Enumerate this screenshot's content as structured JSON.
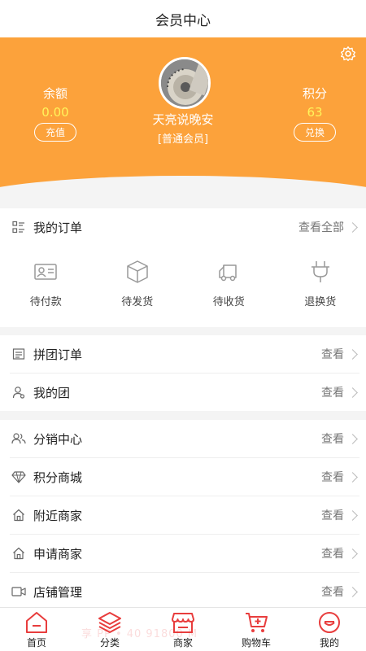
{
  "header": {
    "title": "会员中心"
  },
  "profile": {
    "nickname": "天亮说晚安",
    "level": "[普通会员]",
    "balance": {
      "label": "余额",
      "value": "0.00",
      "button": "充值"
    },
    "points": {
      "label": "积分",
      "value": "63",
      "button": "兑换"
    }
  },
  "orders": {
    "title": "我的订单",
    "view_all": "查看全部",
    "statuses": [
      {
        "label": "待付款",
        "icon": "id-card-icon"
      },
      {
        "label": "待发货",
        "icon": "box-icon"
      },
      {
        "label": "待收货",
        "icon": "truck-icon"
      },
      {
        "label": "退换货",
        "icon": "plug-icon"
      }
    ]
  },
  "group": {
    "rows": [
      {
        "title": "拼团订单",
        "more": "查看",
        "icon": "list-icon"
      },
      {
        "title": "我的团",
        "more": "查看",
        "icon": "user-icon"
      }
    ]
  },
  "services": {
    "rows": [
      {
        "title": "分销中心",
        "more": "查看",
        "icon": "users-icon"
      },
      {
        "title": "积分商城",
        "more": "查看",
        "icon": "diamond-icon"
      },
      {
        "title": "附近商家",
        "more": "查看",
        "icon": "home-icon"
      },
      {
        "title": "申请商家",
        "more": "查看",
        "icon": "home-icon"
      },
      {
        "title": "店铺管理",
        "more": "查看",
        "icon": "video-icon"
      }
    ]
  },
  "tabs": [
    {
      "label": "首页",
      "icon": "home-icon"
    },
    {
      "label": "分类",
      "icon": "layers-icon"
    },
    {
      "label": "商家",
      "icon": "store-icon"
    },
    {
      "label": "购物车",
      "icon": "cart-icon"
    },
    {
      "label": "我的",
      "icon": "face-icon"
    }
  ],
  "watermark": "享 PP • 40 91800 M",
  "colors": {
    "brand": "#fca23b",
    "accent": "#e83d3d",
    "value": "#fff45a"
  }
}
